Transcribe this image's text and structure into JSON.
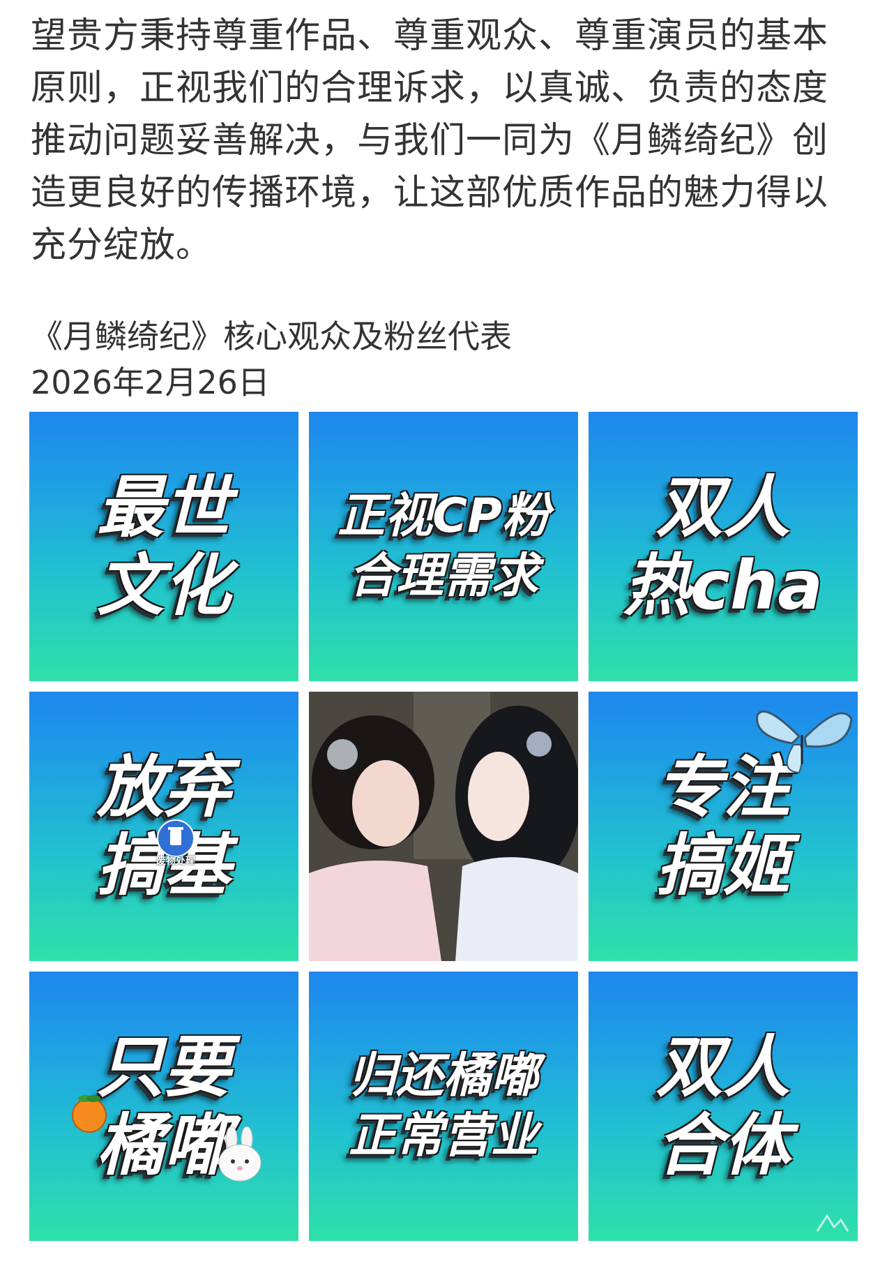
{
  "post": {
    "paragraph": "望贵方秉持尊重作品、尊重观众、尊重演员的基本原则，正视我们的合理诉求，以真诚、负责的态度推动问题妥善解决，与我们一同为《月鳞绮纪》创造更良好的传播环境，让这部优质作品的魅力得以充分绽放。",
    "signature": "《月鳞绮纪》核心观众及粉丝代表",
    "date": "2026年2月26日"
  },
  "grid": {
    "tiles": [
      {
        "text": "最世\n文化"
      },
      {
        "text": "正视CP粉\n合理需求"
      },
      {
        "text": "双人\n热cha"
      },
      {
        "text": "放弃\n搞基"
      },
      {
        "text": ""
      },
      {
        "text": "专注\n搞姬"
      },
      {
        "text": "只要\n橘嘟"
      },
      {
        "text": "归还橘嘟\n正常营业"
      },
      {
        "text": "双人\n合体"
      }
    ],
    "sticker_label": "废物处理"
  },
  "colors": {
    "tile_top": "#1e86ec",
    "tile_bottom": "#2fe0a8",
    "text": "#333333"
  },
  "icons": [
    "recycle-bin-sticker-icon",
    "butterfly-icon",
    "orange-icon",
    "rabbit-icon",
    "watermark-icon"
  ]
}
